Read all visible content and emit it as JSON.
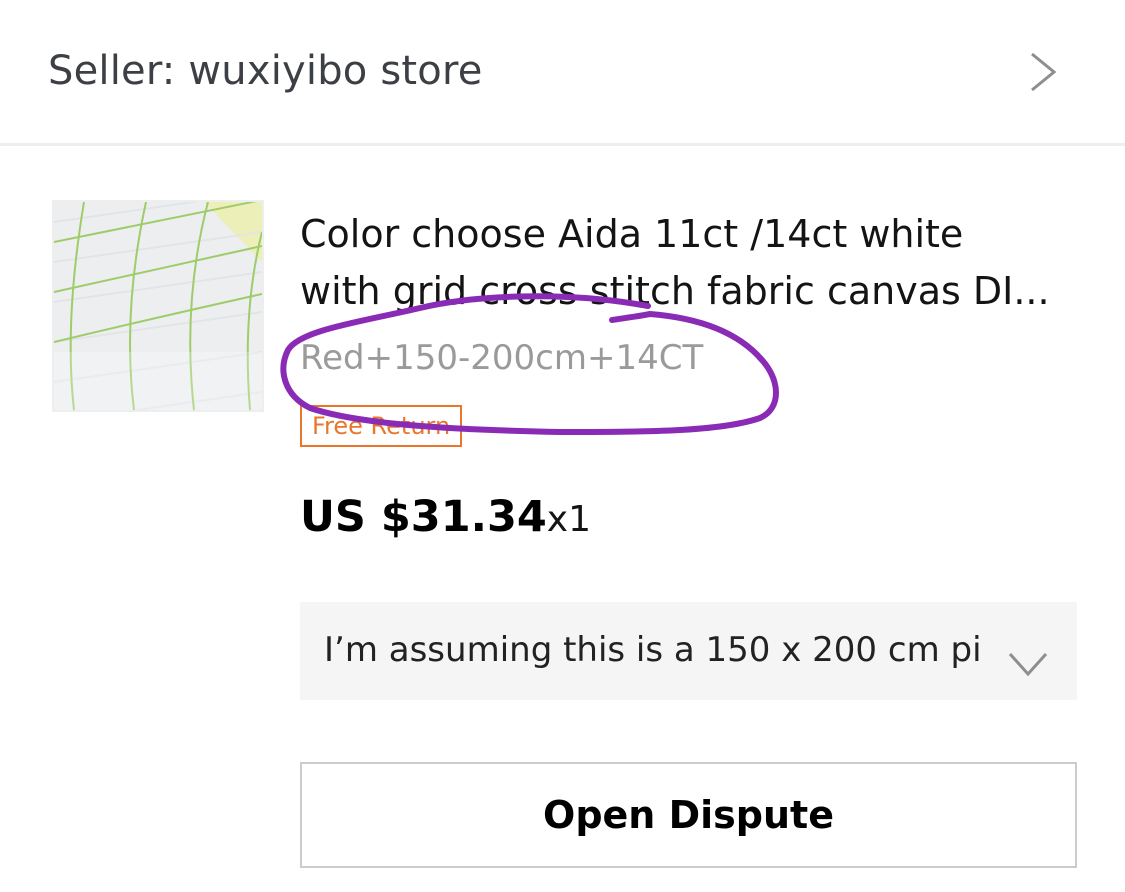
{
  "seller": {
    "label": "Seller: wuxiyibo store",
    "icon": "chevron-right-icon"
  },
  "product": {
    "image_icon": "aida-fabric-thumbnail",
    "title_line1": "Color choose  Aida 11ct /14ct white",
    "title_line2": "with grid cross stitch fabric canvas DI...",
    "sku": "Red+150-200cm+14CT",
    "badge": "Free Return",
    "price": "US $31.34",
    "quantity": "x1"
  },
  "note": {
    "text": "I’m assuming this is a 150 x 200 cm pi...",
    "icon": "chevron-down-icon"
  },
  "actions": {
    "dispute_label": "Open Dispute"
  },
  "colors": {
    "badge_accent": "#e9762b",
    "annotation_stroke": "#8a2bb5",
    "text_primary": "#141414",
    "text_secondary": "#9a9a9a"
  }
}
